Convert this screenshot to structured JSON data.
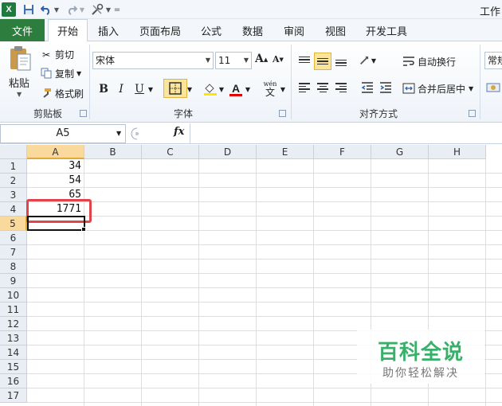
{
  "app": {
    "window_title": "工作"
  },
  "tabs": {
    "file": "文件",
    "home": "开始",
    "insert": "插入",
    "page_layout": "页面布局",
    "formulas": "公式",
    "data": "数据",
    "review": "审阅",
    "view": "视图",
    "developer": "开发工具"
  },
  "clipboard": {
    "paste": "粘贴",
    "cut": "剪切",
    "copy": "复制",
    "format_painter": "格式刷",
    "group": "剪贴板"
  },
  "font": {
    "name": "宋体",
    "size": "11",
    "group": "字体"
  },
  "alignment": {
    "wrap_text": "自动换行",
    "merge_center": "合并后居中",
    "group": "对齐方式"
  },
  "number": {
    "format": "常规"
  },
  "formula_bar": {
    "name_box": "A5",
    "fx": "fx"
  },
  "sheet": {
    "columns": [
      "A",
      "B",
      "C",
      "D",
      "E",
      "F",
      "G",
      "H"
    ],
    "rows": [
      "1",
      "2",
      "3",
      "4",
      "5",
      "6",
      "7",
      "8",
      "9",
      "10",
      "11",
      "12",
      "13",
      "14",
      "15",
      "16",
      "17"
    ],
    "cells": {
      "A1": "34",
      "A2": "54",
      "A3": "65",
      "A4": "1771"
    },
    "active_cell": "A5"
  },
  "watermark": {
    "title": "百科全说",
    "subtitle": "助你轻松解决"
  },
  "colors": {
    "file_tab": "#2d7d3f",
    "highlight": "#e0454b",
    "selected_header": "#f9d99c",
    "watermark_green": "#38b06a"
  }
}
